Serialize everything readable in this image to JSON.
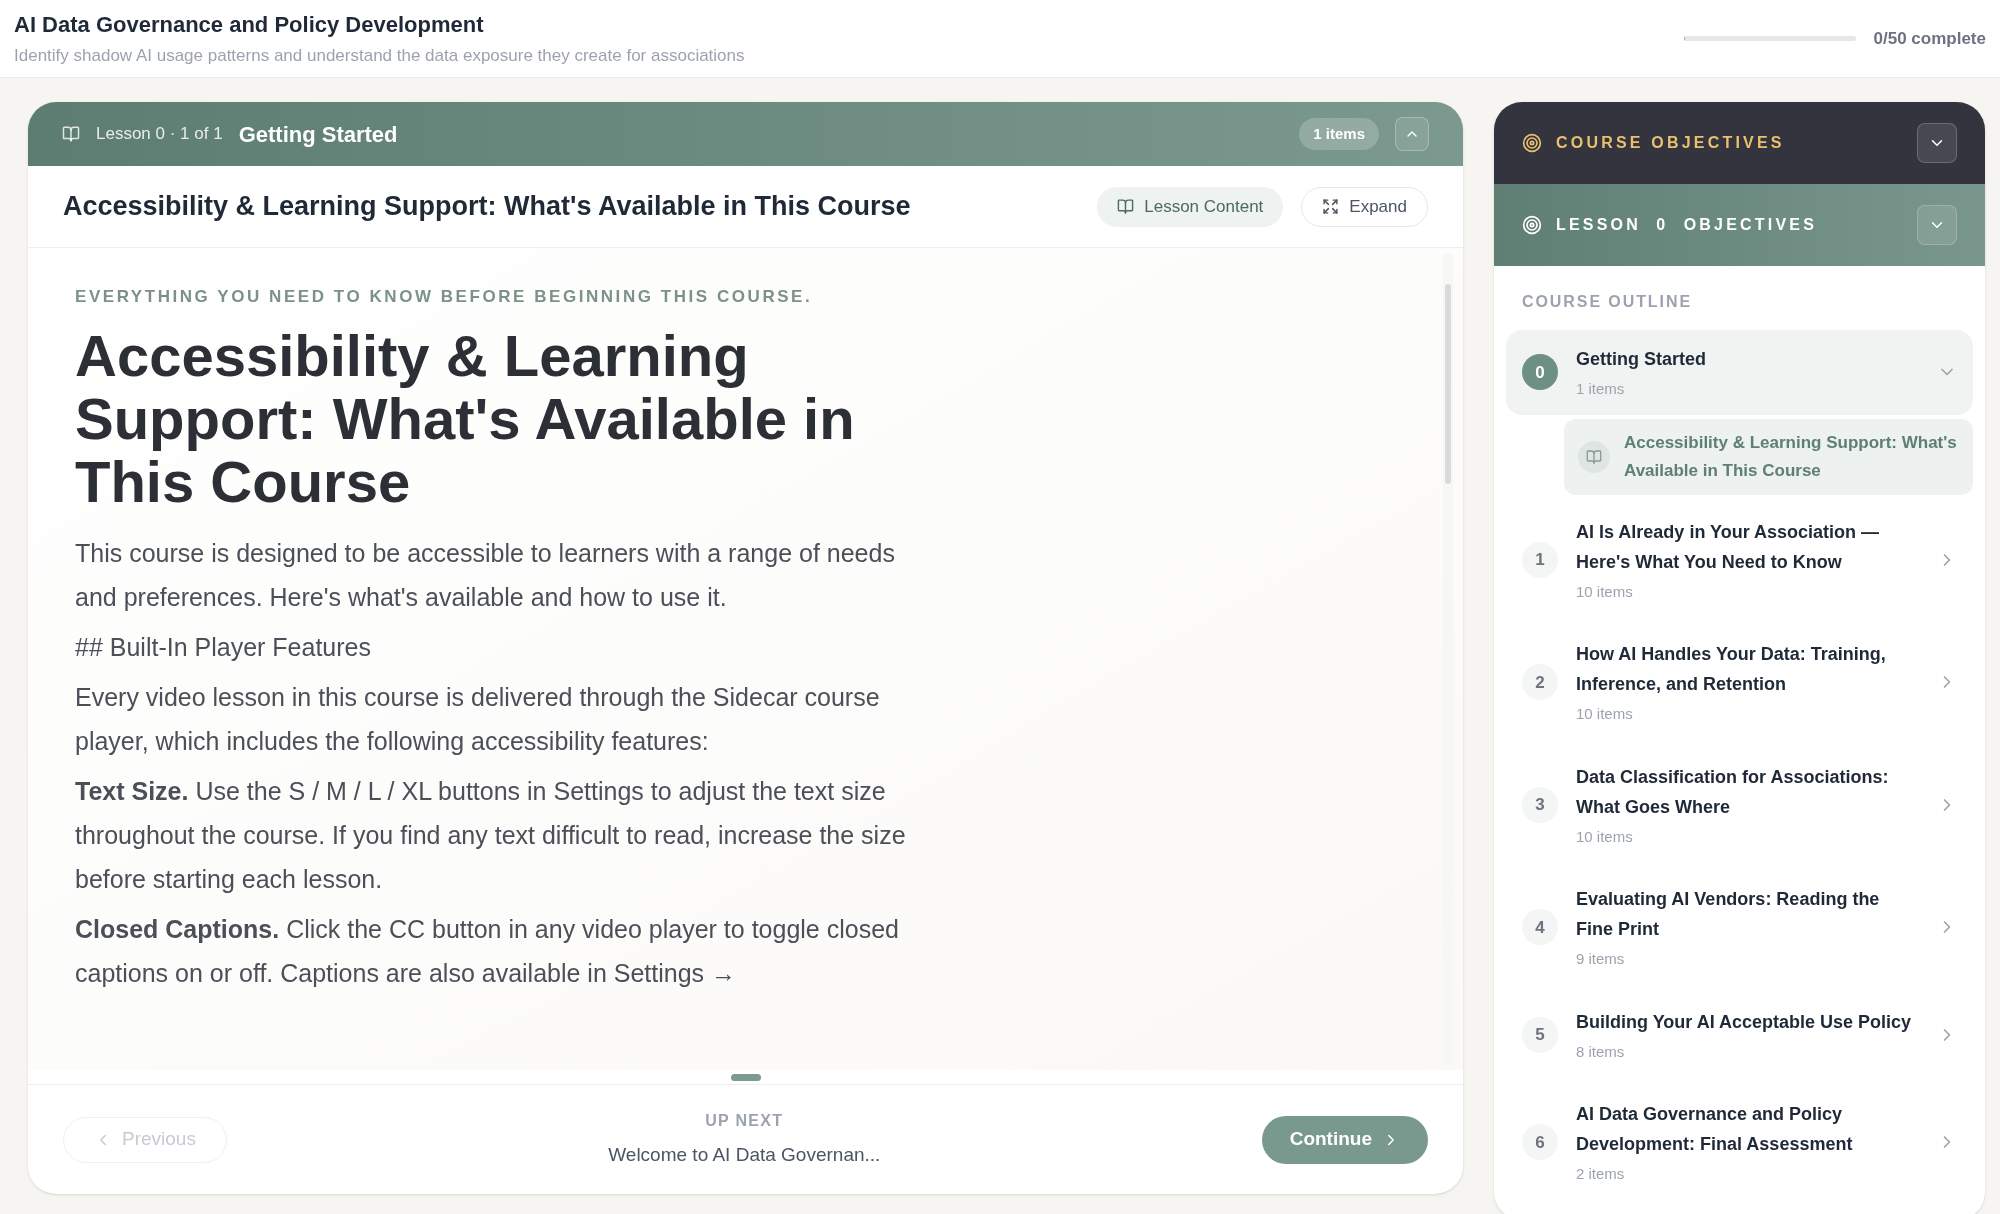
{
  "header": {
    "title": "AI Data Governance and Policy Development",
    "subtitle": "Identify shadow AI usage patterns and understand the data exposure they create for associations",
    "progress": {
      "level": 0.01,
      "label": "0/50 complete"
    }
  },
  "lesson_bar": {
    "label": "Lesson 0 · 1 of 1",
    "title": "Getting Started",
    "badge": "1 items",
    "expanded": true
  },
  "lesson_title": "Accessibility & Learning Support: What's Available in This Course",
  "view_buttons": [
    {
      "kind": "content",
      "label": "Lesson Content",
      "selected": true
    },
    {
      "kind": "expand",
      "label": "Expand",
      "selected": false
    }
  ],
  "content": {
    "eyebrow": "EVERYTHING YOU NEED TO KNOW BEFORE BEGINNING THIS COURSE.",
    "title": "Accessibility & Learning Support: What's Available in This Course",
    "paragraphs": [
      "This course is designed to be accessible to learners with a range of needs and preferences. Here's what's available and how to use it.",
      "## Built-In Player Features",
      "Every video lesson in this course is delivered through the Sidecar course player, which includes the following accessibility features:",
      "**Text Size.** Use the S / M / L / XL buttons in Settings to adjust the text size throughout the course. If you find any text difficult to read, increase the size before starting each lesson.",
      "**Closed Captions.** Click the CC button in any video player to toggle closed captions on or off. Captions are also available in Settings →"
    ]
  },
  "footer": {
    "previous": {
      "label": "Previous",
      "disabled": true
    },
    "up_next_label": "UP NEXT",
    "up_next": "Welcome to AI Data Governan...",
    "continue": {
      "label": "Continue",
      "disabled": false
    }
  },
  "sidebar": {
    "course_objectives": {
      "label": "COURSE OBJECTIVES",
      "expanded": false
    },
    "lesson_objectives": {
      "label": "LESSON  0  OBJECTIVES",
      "expanded": false
    },
    "outline_label": "COURSE OUTLINE",
    "sections": [
      {
        "number": "0",
        "title": "Getting Started",
        "count": "1 items",
        "expanded": true,
        "children": [
          {
            "title": "Accessibility & Learning Support: What's Available in This Course",
            "selected": true
          }
        ]
      },
      {
        "number": "1",
        "title": "AI Is Already in Your Association — Here's What You Need to Know",
        "count": "10 items",
        "expanded": false
      },
      {
        "number": "2",
        "title": "How AI Handles Your Data: Training, Inference, and Retention",
        "count": "10 items",
        "expanded": false
      },
      {
        "number": "3",
        "title": "Data Classification for Associations: What Goes Where",
        "count": "10 items",
        "expanded": false
      },
      {
        "number": "4",
        "title": "Evaluating AI Vendors: Reading the Fine Print",
        "count": "9 items",
        "expanded": false
      },
      {
        "number": "5",
        "title": "Building Your AI Acceptable Use Policy",
        "count": "8 items",
        "expanded": false
      },
      {
        "number": "6",
        "title": "AI Data Governance and Policy Development: Final Assessment",
        "count": "2 items",
        "expanded": false
      }
    ]
  }
}
